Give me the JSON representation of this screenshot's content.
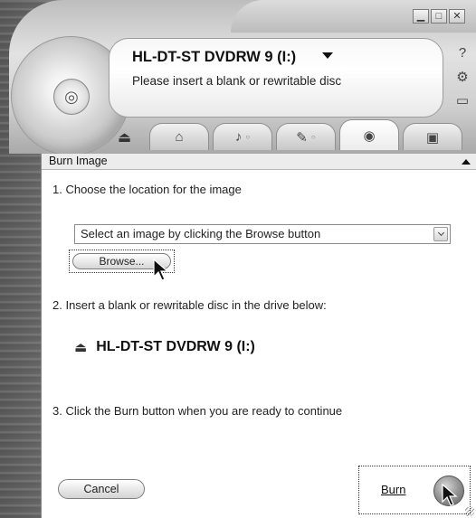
{
  "header": {
    "drive_name": "HL-DT-ST DVDRW 9 (I:)",
    "status": "Please insert a blank or rewritable disc"
  },
  "window_controls": {
    "minimize": "▁",
    "maximize": "□",
    "close": "✕"
  },
  "side_icons": [
    "help-icon",
    "settings-icon",
    "folder-icon"
  ],
  "tabs": [
    {
      "name": "home-icon",
      "glyph": "⌂"
    },
    {
      "name": "music-icon",
      "glyph": "♪"
    },
    {
      "name": "copy-icon",
      "glyph": "✎"
    },
    {
      "name": "burn-disc-icon",
      "glyph": "◉"
    },
    {
      "name": "video-icon",
      "glyph": "▣"
    }
  ],
  "panel": {
    "title": "Burn Image",
    "step1": "1. Choose the location for the image",
    "select_value": "Select an image by clicking the Browse button",
    "browse_label": "Browse...",
    "step2": "2. Insert a blank or rewritable disc in the drive below:",
    "drive_label": "HL-DT-ST DVDRW 9 (I:)",
    "step3": "3. Click the Burn button when you are ready to continue",
    "cancel_label": "Cancel",
    "burn_label": "Burn"
  }
}
